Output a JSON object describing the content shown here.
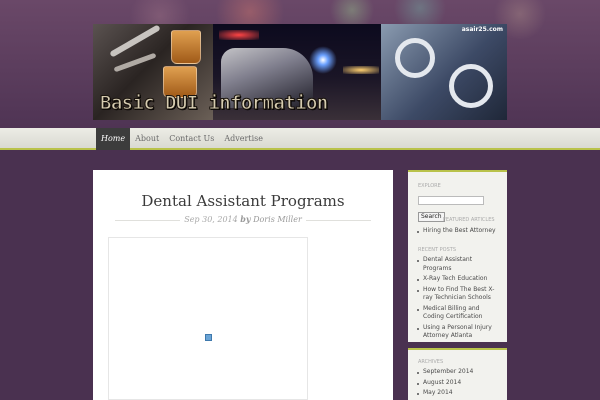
{
  "header": {
    "site_title": "Basic DUI information",
    "watermark": "asair25.com"
  },
  "nav": [
    {
      "label": "Home",
      "active": true
    },
    {
      "label": "About"
    },
    {
      "label": "Contact Us"
    },
    {
      "label": "Advertise"
    }
  ],
  "post": {
    "title": "Dental Assistant Programs",
    "date": "Sep 30, 2014",
    "by": "by",
    "author": "Doris Miller"
  },
  "sidebar": {
    "explore_heading": "EXPLORE",
    "search_button": "Search",
    "featured_heading": "FEATURED ARTICLES",
    "featured": [
      "Hiring the Best Attorney"
    ],
    "recent_heading": "RECENT POSTS",
    "recent": [
      "Dental Assistant Programs",
      "X-Ray Tech Education",
      "How to Find The Best X-ray Technician Schools",
      "Medical Billing and Coding Certification",
      "Using a Personal Injury Attorney Atlanta"
    ],
    "archives_heading": "ARCHIVES",
    "archives": [
      "September 2014",
      "August 2014",
      "May 2014"
    ]
  },
  "colors": {
    "accent": "#b9c24a",
    "background": "#4a3150",
    "nav_active": "#3c3c3c"
  }
}
